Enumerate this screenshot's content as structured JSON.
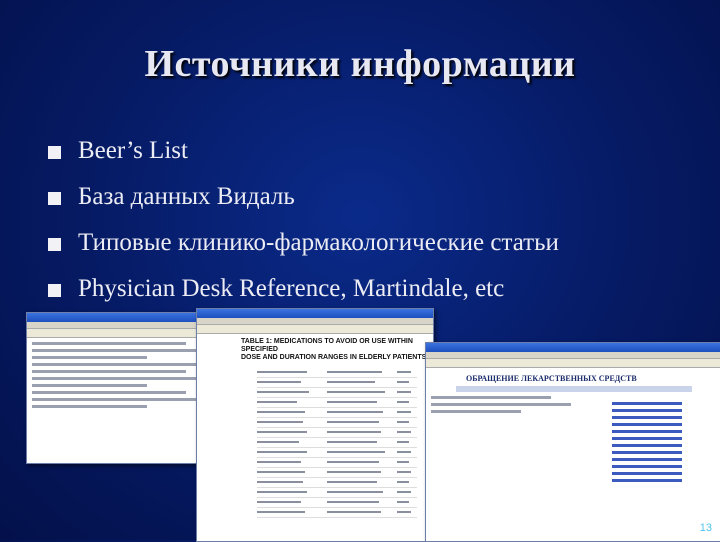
{
  "slide": {
    "title": "Источники информации",
    "bullets": [
      "Beer’s List",
      "База данных Видаль",
      "Типовые клинико-фармакологические статьи",
      "Physician Desk Reference, Martindale, etc"
    ],
    "page_number": "13"
  },
  "screenshots": {
    "table_title_line1": "TABLE 1: MEDICATIONS TO AVOID OR USE WITHIN SPECIFIED",
    "table_title_line2": "DOSE AND DURATION RANGES IN ELDERLY PATIENTS*",
    "portal_heading": "ОБРАЩЕНИЕ ЛЕКАРСТВЕННЫХ СРЕДСТВ"
  },
  "colors": {
    "background": "#061a63",
    "title_text": "#e8e8f2",
    "bullet_text": "#ececf4",
    "page_number": "#4fc3e8"
  }
}
